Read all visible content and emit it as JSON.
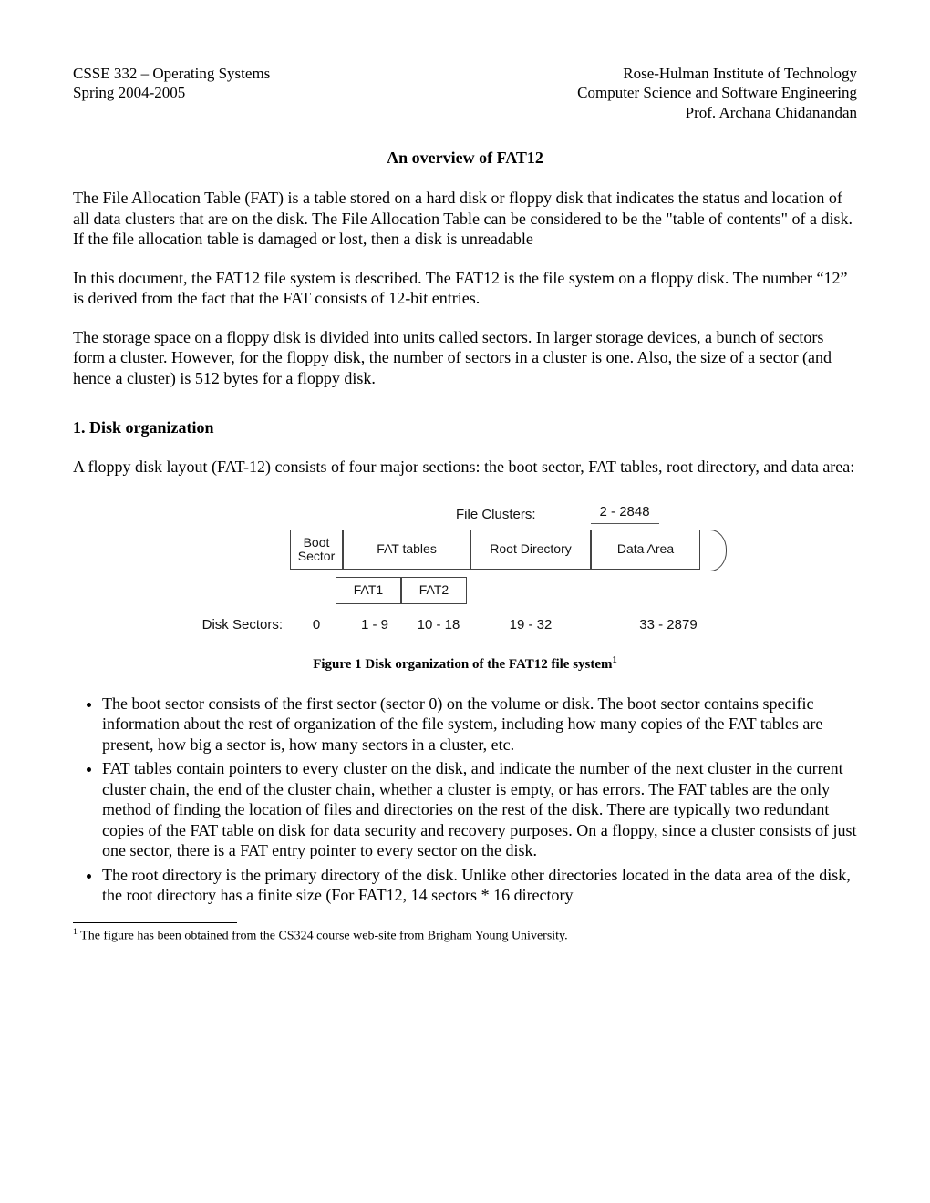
{
  "header": {
    "left1": "CSSE 332 – Operating Systems",
    "left2": "Spring 2004-2005",
    "right1": "Rose-Hulman Institute of Technology",
    "right2": "Computer Science and Software Engineering",
    "right3": "Prof. Archana Chidanandan"
  },
  "title": "An overview of FAT12",
  "p1": "The File Allocation Table (FAT) is a table stored on a hard disk or floppy disk that indicates the status and location of all data clusters that are on the disk. The File Allocation Table can be considered to be the \"table of contents\" of a disk. If the file allocation table is damaged or lost, then a disk is unreadable",
  "p2": "In this document, the FAT12 file system is described. The FAT12 is the file system on a floppy disk. The number “12” is derived from the fact that the FAT consists of 12-bit entries.",
  "p3": "The storage space on a floppy disk is divided into units called sectors. In larger storage devices, a bunch of sectors form a cluster. However, for the floppy disk, the number of sectors in a cluster is one. Also, the size of a sector (and hence a cluster) is 512 bytes for a floppy disk.",
  "section1": "1. Disk organization",
  "p4": "A floppy disk layout (FAT-12) consists of four major sections: the boot sector, FAT tables, root directory, and data area:",
  "figure": {
    "file_clusters_label": "File Clusters:",
    "file_clusters_range": "2 - 2848",
    "boot": "Boot Sector",
    "fat_tables": "FAT tables",
    "root_dir": "Root Directory",
    "data_area": "Data Area",
    "fat1": "FAT1",
    "fat2": "FAT2",
    "disk_sectors_label": "Disk Sectors:",
    "s_boot": "0",
    "s_f1": "1 - 9",
    "s_f2": "10 - 18",
    "s_root": "19 - 32",
    "s_data": "33 - 2879"
  },
  "figure_caption_prefix": "Figure 1 Disk organization of the FAT12 file system",
  "figure_caption_sup": "1",
  "bullets": [
    "The boot sector consists of the first sector (sector 0) on the volume or disk. The boot sector contains specific information about the rest of organization of the file system, including how many copies of the FAT tables are present, how big a sector is, how many sectors in a cluster, etc.",
    "FAT tables contain pointers to every cluster on the disk, and indicate the number of the next cluster in the current cluster chain, the end of the cluster chain, whether a cluster is empty, or has errors. The FAT tables are the only method of finding the location of files and directories on the rest of the disk. There are typically two redundant copies of the FAT table on disk for data security and recovery purposes. On a floppy, since a cluster consists of just one sector, there is a FAT entry pointer to every sector on the disk.",
    "The root directory is the primary directory of the disk. Unlike other directories located in the data area of the disk, the root directory has a finite size (For FAT12, 14 sectors * 16 directory"
  ],
  "footnote_marker": "1",
  "footnote_text": " The figure has been obtained from the CS324 course web-site from Brigham Young University."
}
